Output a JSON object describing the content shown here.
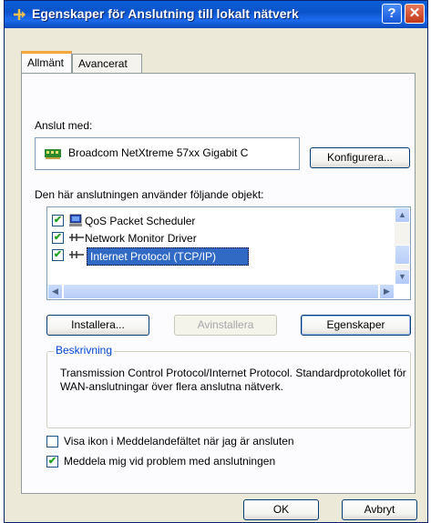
{
  "window": {
    "title": "Egenskaper för Anslutning till lokalt nätverk",
    "help_label": "?",
    "close_label": "✕"
  },
  "tabs": [
    {
      "label": "Allmänt",
      "active": true
    },
    {
      "label": "Avancerat",
      "active": false
    }
  ],
  "general": {
    "connect_using_label": "Anslut med:",
    "adapter_name": "Broadcom NetXtreme 57xx Gigabit C",
    "configure_button": "Konfigurera...",
    "components_label": "Den här anslutningen använder följande objekt:",
    "components": [
      {
        "label": "QoS Packet Scheduler",
        "checked": true,
        "icon": "qos-icon",
        "selected": false
      },
      {
        "label": "Network Monitor Driver",
        "checked": true,
        "icon": "network-protocol-icon",
        "selected": false
      },
      {
        "label": "Internet Protocol (TCP/IP)",
        "checked": true,
        "icon": "network-protocol-icon",
        "selected": true
      }
    ],
    "install_button": "Installera...",
    "uninstall_button": "Avinstallera",
    "properties_button": "Egenskaper",
    "description_title": "Beskrivning",
    "description_text": "Transmission Control Protocol/Internet Protocol. Standardprotokollet för WAN-anslutningar över flera anslutna nätverk.",
    "show_icon_option": {
      "label": "Visa ikon i Meddelandefältet när jag är ansluten",
      "checked": false
    },
    "notify_option": {
      "label": "Meddela mig vid problem med anslutningen",
      "checked": true
    }
  },
  "footer": {
    "ok_button": "OK",
    "cancel_button": "Avbryt"
  },
  "colors": {
    "titlebar": "#0b53c9",
    "selection": "#316ac5",
    "tab_accent": "#f3a73b"
  }
}
